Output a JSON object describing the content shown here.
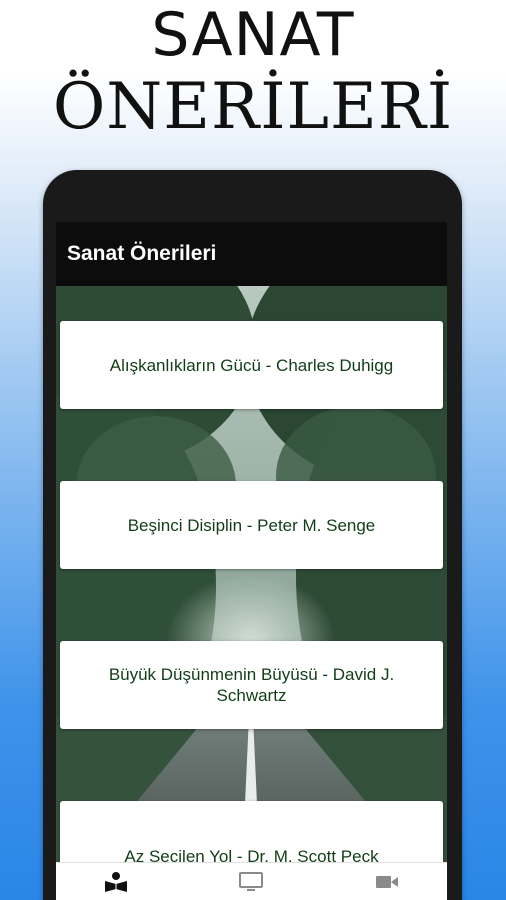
{
  "promo": {
    "line1": "SANAT",
    "line2": "ÖNERİLERİ"
  },
  "app": {
    "title": "Sanat Önerileri"
  },
  "list": {
    "items": [
      {
        "label": "Alışkanlıkların Gücü - Charles Duhigg"
      },
      {
        "label": "Beşinci Disiplin - Peter M. Senge"
      },
      {
        "label": "Büyük Düşünmenin Büyüsü - David J. Schwartz"
      },
      {
        "label": "Az Seçilen Yol - Dr. M. Scott Peck"
      }
    ]
  },
  "bottom_nav": {
    "items": [
      {
        "icon": "book-reader-icon",
        "active": true
      },
      {
        "icon": "monitor-icon",
        "active": false
      },
      {
        "icon": "video-camera-icon",
        "active": false
      }
    ]
  },
  "colors": {
    "app_bar": "#0c0c0c",
    "card_text": "#123d17",
    "nav_active": "#111111",
    "nav_inactive": "#8a8a8a"
  }
}
